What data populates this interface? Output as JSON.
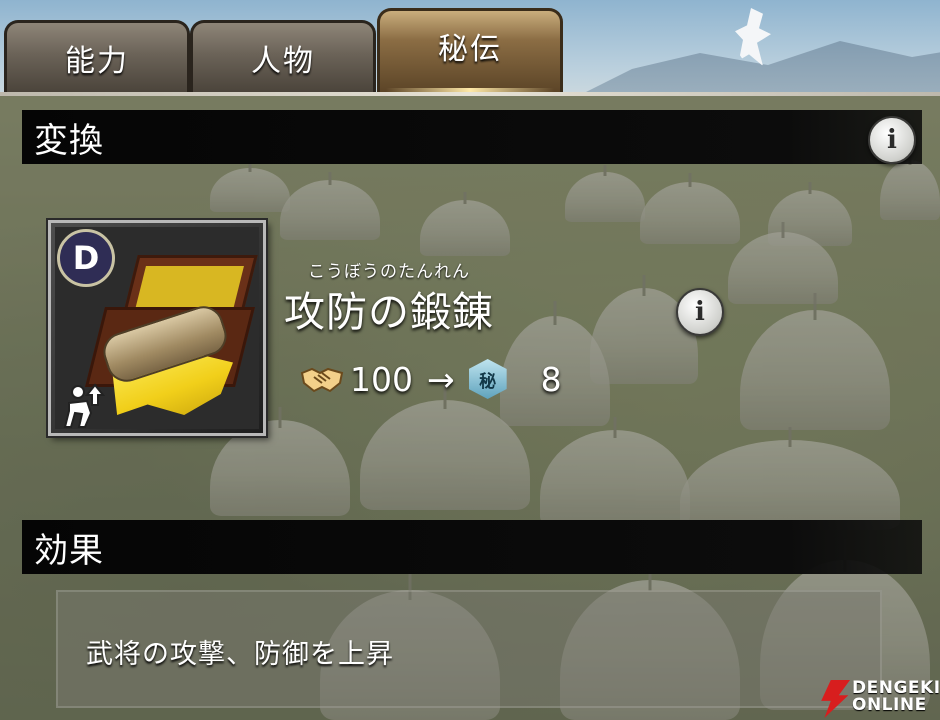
{
  "tabs": [
    {
      "label": "能力",
      "active": false
    },
    {
      "label": "人物",
      "active": false
    },
    {
      "label": "秘伝",
      "active": true
    }
  ],
  "conversion_section": {
    "title": "変換",
    "info_icon": "info-icon"
  },
  "item": {
    "rank": "D",
    "image": "scroll-box-icon",
    "boost_icon": "stat-up-icon"
  },
  "skill": {
    "ruby": "こうぼうのたんれん",
    "name": "攻防の鍛錬",
    "info_icon": "info-icon"
  },
  "conversion": {
    "from_icon": "handshake-icon",
    "from_value": "100",
    "arrow": "→",
    "to_icon_label": "秘",
    "to_value": "8"
  },
  "effect_section": {
    "title": "効果",
    "description": "武将の攻撃、防御を上昇"
  },
  "watermark": {
    "top": "DENGEKI",
    "bottom": "ONLINE"
  },
  "colors": {
    "active_tab": "#8b6d44",
    "section_bar": "#050505",
    "rank_badge": "#2f2d55",
    "silk": "#f1cf1a",
    "secret_icon": "#5fa3bd"
  }
}
